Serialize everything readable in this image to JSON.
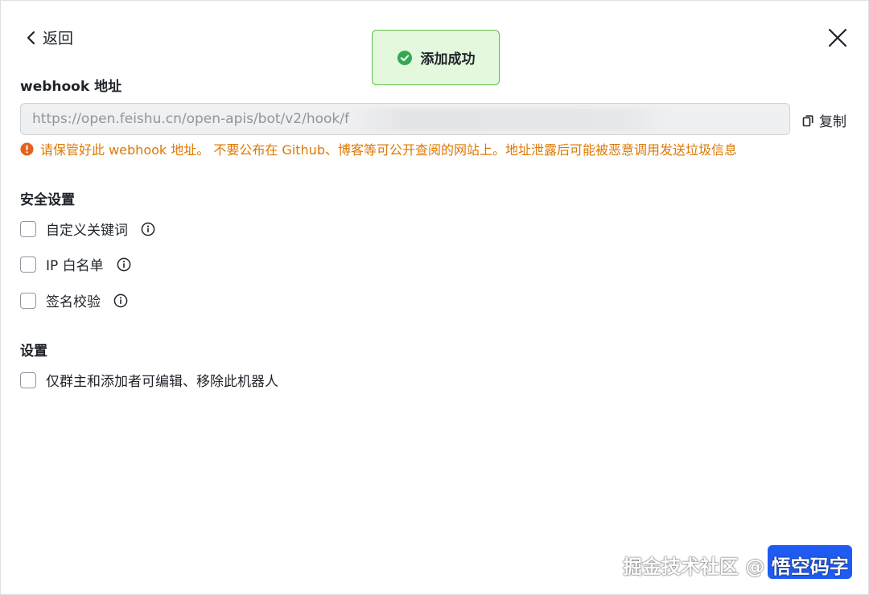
{
  "header": {
    "back_label": "返回"
  },
  "toast": {
    "message": "添加成功"
  },
  "webhook": {
    "title": "webhook 地址",
    "url": "https://open.feishu.cn/open-apis/bot/v2/hook/f",
    "copy_label": "复制",
    "warning": "请保管好此 webhook 地址。 不要公布在 Github、博客等可公开查阅的网站上。地址泄露后可能被恶意调用发送垃圾信息"
  },
  "security": {
    "title": "安全设置",
    "options": [
      {
        "label": "自定义关键词",
        "checked": false
      },
      {
        "label": "IP 白名单",
        "checked": false
      },
      {
        "label": "签名校验",
        "checked": false
      }
    ]
  },
  "settings": {
    "title": "设置",
    "options": [
      {
        "label": "仅群主和添加者可编辑、移除此机器人",
        "checked": false
      }
    ]
  },
  "watermark": {
    "text": "掘金技术社区 @ 悟空码字"
  },
  "colors": {
    "warning": "#de7802",
    "success": "#34a853",
    "toast_bg": "#e4f8de",
    "primary": "#1f5bf2"
  }
}
